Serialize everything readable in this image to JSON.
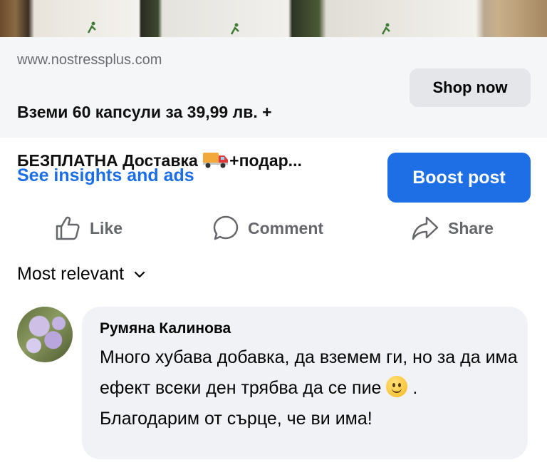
{
  "ad": {
    "domain": "www.nostressplus.com",
    "title_line1": "Вземи 60 капсули за 39,99 лв. +",
    "title_line2_prefix": "БЕЗПЛАТНА Доставка ",
    "title_line2_suffix": "+подар...",
    "truck_icon": "delivery-truck-emoji",
    "cta_label": "Shop now"
  },
  "post_actions": {
    "insights_label": "See insights and ads",
    "boost_label": "Boost post",
    "like_label": "Like",
    "comment_label": "Comment",
    "share_label": "Share"
  },
  "comments": {
    "sort_label": "Most relevant",
    "items": [
      {
        "author": "Румяна Калинова",
        "text_before_emoji": "Много хубава добавка, да вземем ги, но за да има ефект всеки ден трябва да се пие ",
        "emoji": "slightly-smiling-face",
        "text_after_emoji": " . Благодарим от сърце, че ви има!"
      }
    ]
  },
  "colors": {
    "accent_blue": "#1e6fe5",
    "link_blue": "#1b6ee6",
    "muted_gray": "#65676b",
    "bubble_bg": "#f0f2f5"
  }
}
